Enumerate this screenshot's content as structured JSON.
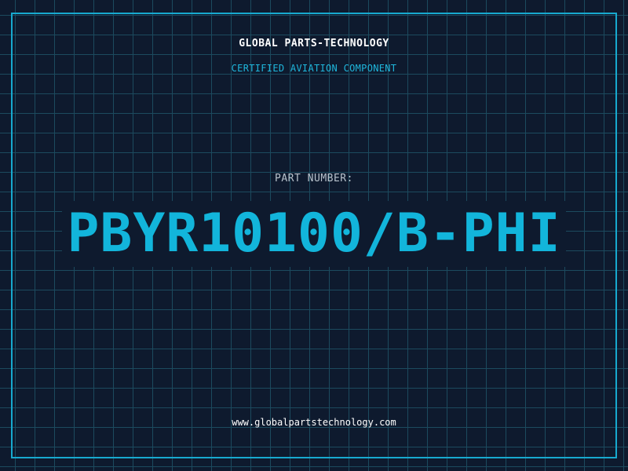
{
  "header": {
    "company": "GLOBAL PARTS-TECHNOLOGY",
    "tagline": "CERTIFIED AVIATION COMPONENT"
  },
  "part": {
    "label": "PART NUMBER:",
    "number": "PBYR10100/B-PHI"
  },
  "footer": {
    "website": "www.globalpartstechnology.com"
  },
  "colors": {
    "background": "#0e1a2e",
    "grid": "#1c4a5e",
    "accent": "#17a9cf",
    "text": "#ffffff"
  }
}
